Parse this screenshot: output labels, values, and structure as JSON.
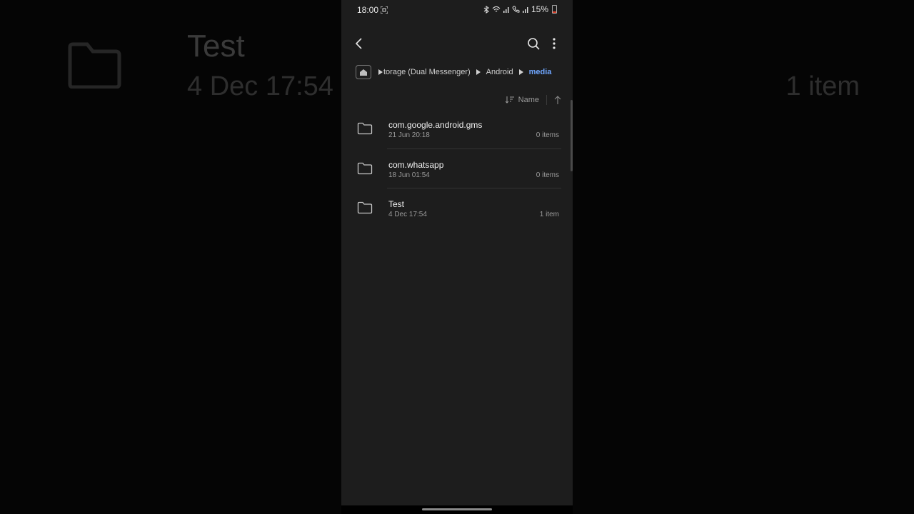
{
  "background": {
    "title": "Test",
    "date": "4 Dec 17:54",
    "count": "1 item"
  },
  "status_bar": {
    "time": "18:00",
    "battery": "15%",
    "icons": [
      "screenshot-icon",
      "bluetooth-icon",
      "wifi-icon",
      "signal-icon",
      "call-icon",
      "signal-icon-2",
      "battery-icon"
    ],
    "battery_color": "#e0452f"
  },
  "appbar": {
    "icons": [
      "back-icon",
      "search-icon",
      "more-vert-icon"
    ]
  },
  "breadcrumb": {
    "items": [
      "torage (Dual Messenger)",
      "Android",
      "media"
    ],
    "active_color": "#6fa6ff"
  },
  "sort": {
    "label": "Name"
  },
  "files": [
    {
      "name": "com.google.android.gms",
      "date": "21 Jun 20:18",
      "count": "0 items"
    },
    {
      "name": "com.whatsapp",
      "date": "18 Jun 01:54",
      "count": "0 items"
    },
    {
      "name": "Test",
      "date": "4 Dec 17:54",
      "count": "1 item"
    }
  ]
}
